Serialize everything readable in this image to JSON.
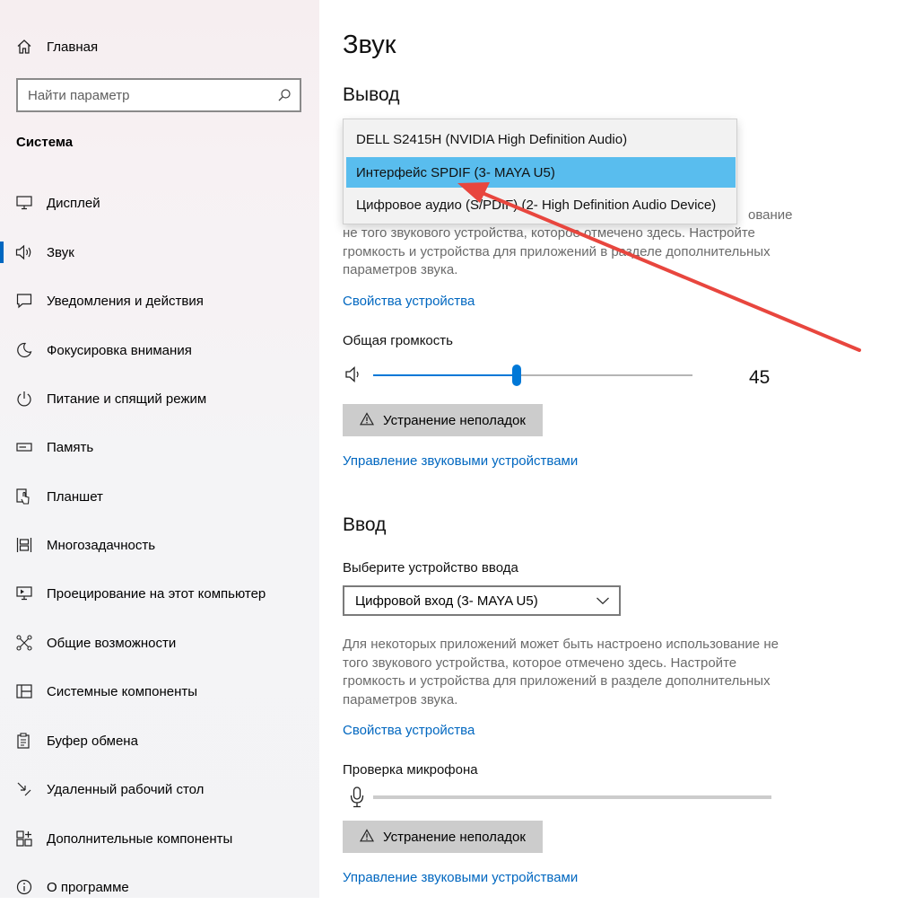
{
  "sidebar": {
    "home_label": "Главная",
    "search_placeholder": "Найти параметр",
    "section_title": "Система",
    "items": [
      {
        "label": "Дисплей",
        "icon": "monitor-icon"
      },
      {
        "label": "Звук",
        "icon": "speaker-icon",
        "active": true
      },
      {
        "label": "Уведомления и действия",
        "icon": "notification-icon"
      },
      {
        "label": "Фокусировка внимания",
        "icon": "moon-icon"
      },
      {
        "label": "Питание и спящий режим",
        "icon": "power-icon"
      },
      {
        "label": "Память",
        "icon": "storage-icon"
      },
      {
        "label": "Планшет",
        "icon": "tablet-icon"
      },
      {
        "label": "Многозадачность",
        "icon": "multitasking-icon"
      },
      {
        "label": "Проецирование на этот компьютер",
        "icon": "projecting-icon"
      },
      {
        "label": "Общие возможности",
        "icon": "shared-experiences-icon"
      },
      {
        "label": "Системные компоненты",
        "icon": "system-components-icon"
      },
      {
        "label": "Буфер обмена",
        "icon": "clipboard-icon"
      },
      {
        "label": "Удаленный рабочий стол",
        "icon": "remote-desktop-icon"
      },
      {
        "label": "Дополнительные компоненты",
        "icon": "optional-features-icon"
      },
      {
        "label": "О программе",
        "icon": "info-icon"
      }
    ]
  },
  "main": {
    "title": "Звук",
    "output": {
      "heading": "Вывод",
      "dropdown_options": [
        "DELL S2415H (NVIDIA High Definition Audio)",
        "Интерфейс SPDIF (3- MAYA U5)",
        "Цифровое аудио (S/PDIF) (2- High Definition Audio Device)"
      ],
      "selected_index": 1,
      "helper_text_visible": "не того звукового устройства, которое отмечено здесь. Настройте громкость и устройства для приложений в разделе дополнительных параметров звука.",
      "helper_text_tail": "ование",
      "device_properties_link": "Свойства устройства",
      "volume_label": "Общая громкость",
      "volume_value": "45",
      "volume_fraction": 0.45,
      "troubleshoot_label": "Устранение неполадок",
      "manage_link": "Управление звуковыми устройствами"
    },
    "input": {
      "heading": "Ввод",
      "choose_label": "Выберите устройство ввода",
      "selected_device": "Цифровой вход (3- MAYA U5)",
      "helper_text": "Для некоторых приложений может быть настроено использование не того звукового устройства, которое отмечено здесь. Настройте громкость и устройства для приложений в разделе дополнительных параметров звука.",
      "device_properties_link": "Свойства устройства",
      "mic_test_label": "Проверка микрофона",
      "troubleshoot_label": "Устранение неполадок",
      "manage_link": "Управление звуковыми устройствами"
    }
  },
  "annotation": {
    "arrow_color": "#e8463e"
  },
  "colors": {
    "accent": "#0078d7",
    "link": "#0067c0",
    "dropdown_selected": "#59bdee"
  }
}
